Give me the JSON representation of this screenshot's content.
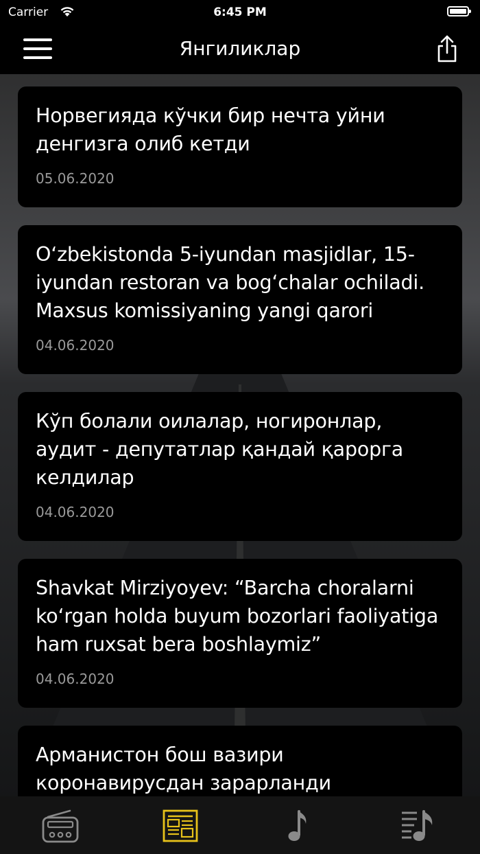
{
  "status_bar": {
    "carrier": "Carrier",
    "time": "6:45 PM"
  },
  "nav": {
    "title": "Янгиликлар",
    "menu_icon": "hamburger-icon",
    "share_icon": "share-icon"
  },
  "articles": [
    {
      "title": "Норвегияда кўчки бир нечта уйни денгизга олиб кетди",
      "date": "05.06.2020"
    },
    {
      "title": "O‘zbekistonda 5-iyundan masjidlar, 15-iyundan restoran va bog‘chalar ochiladi. Maxsus komissiyaning yangi qarori",
      "date": "04.06.2020"
    },
    {
      "title": "Кўп болали оилалар, ногиронлар, аудит - депутатлар қандай қарорга келдилар",
      "date": "04.06.2020"
    },
    {
      "title": "Shavkat Mirziyoyev: “Barcha choralarni ko‘rgan holda buyum bozorlari faoliyatiga ham ruxsat bera boshlaymiz”",
      "date": "04.06.2020"
    },
    {
      "title": "Арманистон бош вазири коронавирусдан зарарланди",
      "date": ""
    }
  ],
  "tabs": [
    {
      "icon": "radio-icon",
      "active": false
    },
    {
      "icon": "news-icon",
      "active": true
    },
    {
      "icon": "music-note-icon",
      "active": false
    },
    {
      "icon": "playlist-icon",
      "active": false
    }
  ],
  "colors": {
    "active_tab": "#e8c21a",
    "inactive_tab": "#8a8a8a",
    "card_bg": "#000000",
    "date_text": "#9a9a9a"
  }
}
